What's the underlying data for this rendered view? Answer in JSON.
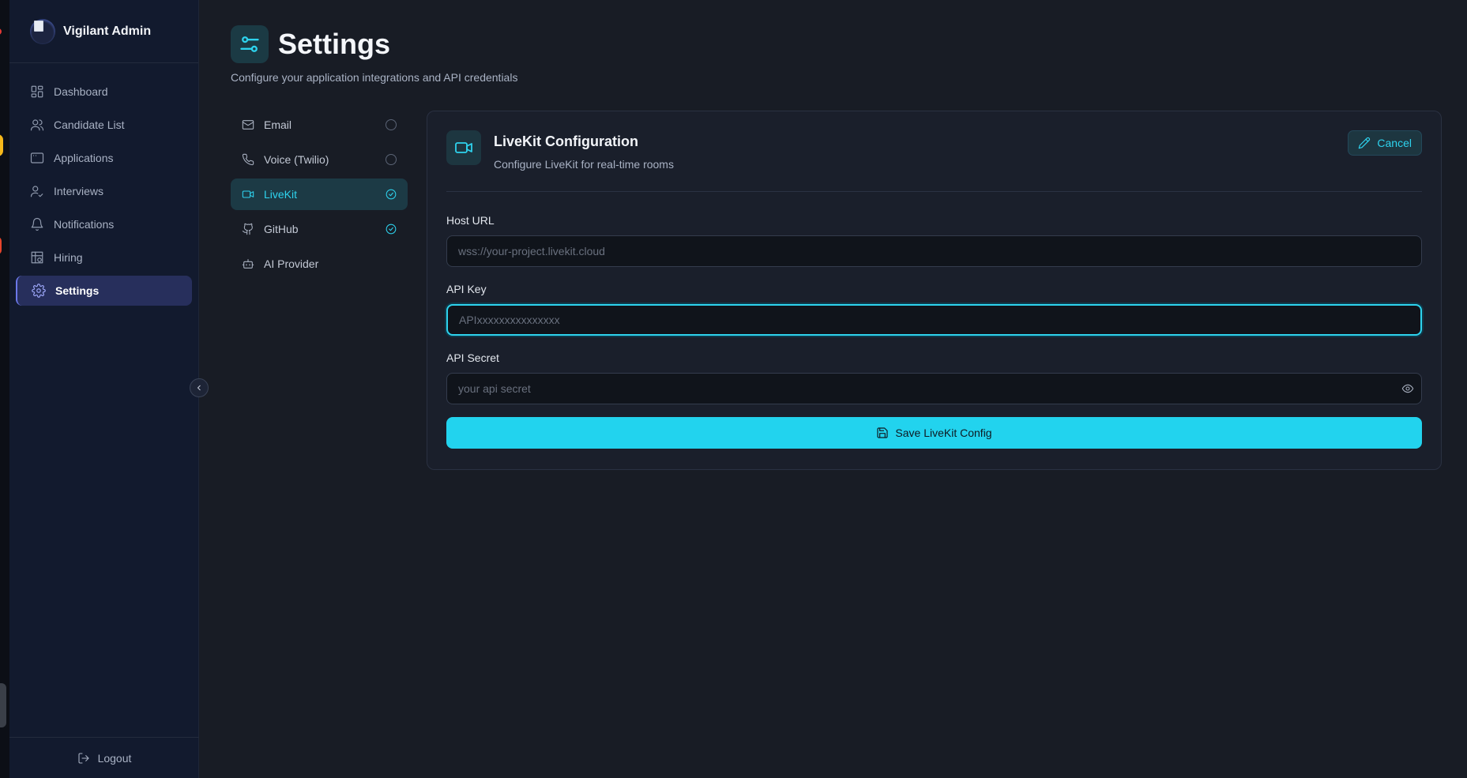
{
  "app": {
    "brand_name": "Vigilant Admin"
  },
  "sidebar": {
    "items": [
      {
        "label": "Dashboard",
        "icon": "dashboard-icon",
        "active": false
      },
      {
        "label": "Candidate List",
        "icon": "users-icon",
        "active": false
      },
      {
        "label": "Applications",
        "icon": "window-icon",
        "active": false
      },
      {
        "label": "Interviews",
        "icon": "user-check-icon",
        "active": false
      },
      {
        "label": "Notifications",
        "icon": "bell-icon",
        "active": false
      },
      {
        "label": "Hiring",
        "icon": "grid-icon",
        "active": false
      },
      {
        "label": "Settings",
        "icon": "gear-icon",
        "active": true
      }
    ],
    "logout_label": "Logout"
  },
  "page": {
    "title": "Settings",
    "subtitle": "Configure your application integrations and API credentials"
  },
  "settings_nav": {
    "items": [
      {
        "label": "Email",
        "icon": "mail-icon",
        "configured": false,
        "active": false
      },
      {
        "label": "Voice (Twilio)",
        "icon": "phone-icon",
        "configured": false,
        "active": false
      },
      {
        "label": "LiveKit",
        "icon": "video-icon",
        "configured": true,
        "active": true
      },
      {
        "label": "GitHub",
        "icon": "github-icon",
        "configured": true,
        "active": false
      },
      {
        "label": "AI Provider",
        "icon": "bot-icon",
        "configured": null,
        "active": false
      }
    ]
  },
  "panel": {
    "title": "LiveKit Configuration",
    "description": "Configure LiveKit for real-time rooms",
    "cancel_label": "Cancel",
    "fields": {
      "host_url": {
        "label": "Host URL",
        "value": "",
        "placeholder": "wss://your-project.livekit.cloud"
      },
      "api_key": {
        "label": "API Key",
        "value": "",
        "placeholder": "APIxxxxxxxxxxxxxxx"
      },
      "api_secret": {
        "label": "API Secret",
        "value": "",
        "placeholder": "your api secret"
      }
    },
    "save_label": "Save LiveKit Config"
  },
  "colors": {
    "accent": "#22d3ee",
    "sidebar_active": "#272f5c",
    "background": "#181c25"
  }
}
